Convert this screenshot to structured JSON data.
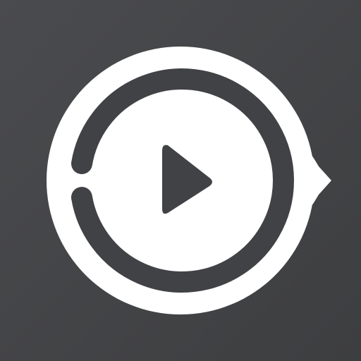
{
  "app_icon": {
    "icon": "play-button-speech-bubble-icon",
    "colors": {
      "background": "#3d3e40",
      "background_highlight": "#4a4b4e",
      "foreground": "#ffffff",
      "ring": "#414245"
    }
  }
}
